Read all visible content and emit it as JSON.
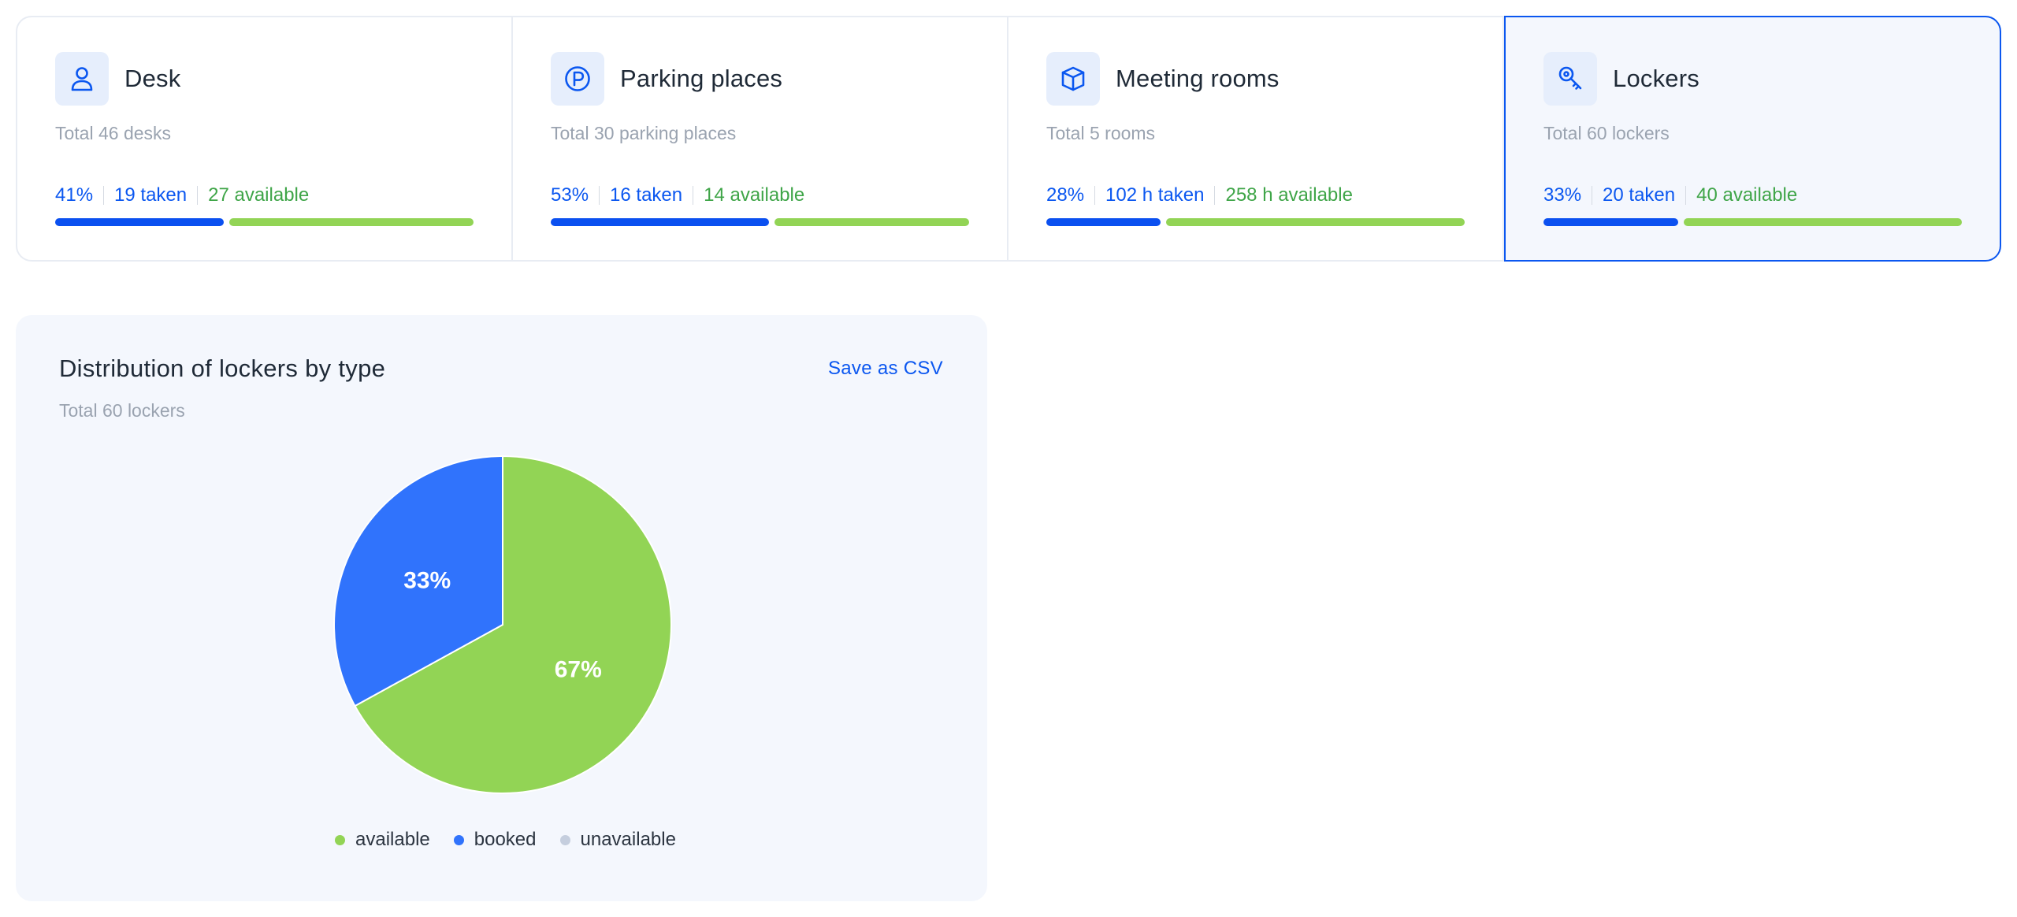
{
  "colors": {
    "accent": "#0b57f0",
    "taken": "#0b50f0",
    "available": "#92d455",
    "available_text": "#3fa548",
    "booked": "#3073fc",
    "unavailable": "#c5cede"
  },
  "cards": [
    {
      "title": "Desk",
      "icon": "person-icon",
      "total": "Total 46 desks",
      "percent": "41%",
      "taken": "19 taken",
      "available": "27 available",
      "taken_fraction": 0.41
    },
    {
      "title": "Parking places",
      "icon": "parking-icon",
      "total": "Total 30 parking places",
      "percent": "53%",
      "taken": "16 taken",
      "available": "14 available",
      "taken_fraction": 0.53
    },
    {
      "title": "Meeting rooms",
      "icon": "cube-icon",
      "total": "Total 5 rooms",
      "percent": "28%",
      "taken": "102 h taken",
      "available": "258 h available",
      "taken_fraction": 0.28
    },
    {
      "title": "Lockers",
      "icon": "key-icon",
      "total": "Total 60 lockers",
      "percent": "33%",
      "taken": "20 taken",
      "available": "40 available",
      "taken_fraction": 0.33,
      "selected": true
    }
  ],
  "panel": {
    "title": "Distribution of lockers by type",
    "subtitle": "Total 60 lockers",
    "csv_label": "Save as CSV"
  },
  "chart_data": {
    "type": "pie",
    "categories": [
      "available",
      "booked",
      "unavailable"
    ],
    "values": [
      67,
      33,
      0
    ],
    "labels": [
      "67%",
      "33%",
      ""
    ],
    "colors": [
      "#92d455",
      "#3073fc",
      "#c5cede"
    ],
    "legend": "bottom"
  }
}
